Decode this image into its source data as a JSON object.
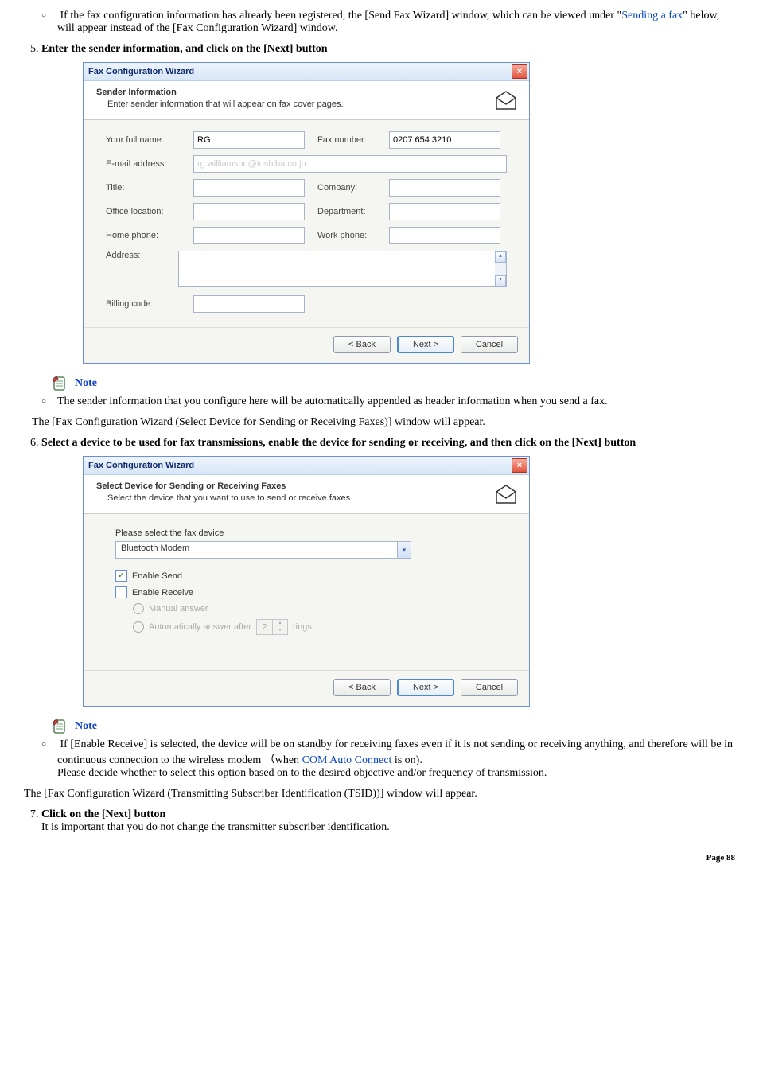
{
  "bullets": {
    "pre5": {
      "prefix": "If the fax configuration information has already been registered, the [Send Fax Wizard] window, which can be viewed under \"",
      "link": "Sending a fax",
      "suffix": "\" below, will appear instead of the [Fax Configuration Wizard] window."
    }
  },
  "steps": {
    "s5": "Enter the sender information, and click on the [Next] button",
    "s6": "Select a device to be used for fax transmissions, enable the device for sending or receiving, and then click on the [Next] button",
    "s7": "Click on the [Next] button",
    "s7_body": "It is important that you do not change the transmitter subscriber identification."
  },
  "note_label": "Note",
  "note_after5": "The sender information that you configure here will be automatically appended as header information when you send a fax.",
  "para_after_note5": "The [Fax Configuration Wizard (Select Device for Sending or Receiving Faxes)] window will appear.",
  "note_after6": {
    "line1": "If [Enable Receive] is selected, the device will be on standby for receiving faxes even if it is not sending or receiving anything, and therefore will be in continuous connection to the wireless modem （when ",
    "link": "COM Auto Connect",
    "line1b": " is on).",
    "line2": "Please decide whether to select this option based on to the desired objective and/or frequency of transmission."
  },
  "para_after_note6": "The [Fax Configuration Wizard (Transmitting Subscriber Identification (TSID))] window will appear.",
  "page_footer": "Page  88",
  "wiz1": {
    "window_title": "Fax Configuration Wizard",
    "header_title": "Sender Information",
    "header_sub": "Enter sender information that will appear on fax cover pages.",
    "labels": {
      "your_full_name": "Your full name:",
      "fax_number": "Fax number:",
      "email": "E-mail address:",
      "title": "Title:",
      "company": "Company:",
      "office": "Office location:",
      "department": "Department:",
      "home_phone": "Home phone:",
      "work_phone": "Work phone:",
      "address": "Address:",
      "billing": "Billing code:"
    },
    "values": {
      "your_full_name": "RG",
      "fax_number": "0207 654 3210",
      "email_blur": "rg.williamson@toshiba.co.jp"
    },
    "buttons": {
      "back": "< Back",
      "next": "Next >",
      "cancel": "Cancel"
    }
  },
  "wiz2": {
    "window_title": "Fax Configuration Wizard",
    "header_title": "Select Device for Sending or Receiving Faxes",
    "header_sub": "Select the device that you want to use to send or receive faxes.",
    "please_select": "Please select the fax device",
    "device": "Bluetooth Modem",
    "enable_send": "Enable Send",
    "enable_receive": "Enable Receive",
    "manual": "Manual answer",
    "auto": "Automatically answer after",
    "rings_value": "2",
    "rings_label": "rings",
    "buttons": {
      "back": "< Back",
      "next": "Next >",
      "cancel": "Cancel"
    }
  }
}
